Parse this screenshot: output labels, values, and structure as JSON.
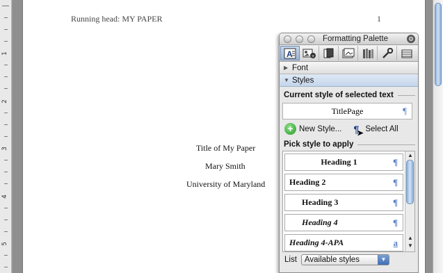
{
  "ruler": {
    "numbers": [
      "1",
      "2",
      "3",
      "4",
      "5"
    ]
  },
  "document": {
    "running_head": "Running head: MY PAPER",
    "page_number": "1",
    "title": "Title of My Paper",
    "author": "Mary Smith",
    "institution": "University of Maryland"
  },
  "palette": {
    "title": "Formatting Palette",
    "toolbar_icons": [
      "formatting-icon",
      "object-icon",
      "citations-icon",
      "clip-icon",
      "reference-tools-icon",
      "toolbox-icon",
      "scrapbook-icon"
    ],
    "panes": {
      "font": "Font",
      "styles": "Styles"
    },
    "current_style_label": "Current style of selected text",
    "current_style_value": "TitlePage",
    "new_style": "New Style...",
    "select_all": "Select All",
    "pick_style_label": "Pick style to apply",
    "styles": [
      {
        "name": "Heading 1",
        "marker": "¶"
      },
      {
        "name": "Heading 2",
        "marker": "¶"
      },
      {
        "name": "Heading 3",
        "marker": "¶"
      },
      {
        "name": "Heading 4",
        "marker": "¶"
      },
      {
        "name": "Heading 4-APA",
        "marker": "a"
      }
    ],
    "list_label": "List",
    "list_value": "Available styles"
  }
}
